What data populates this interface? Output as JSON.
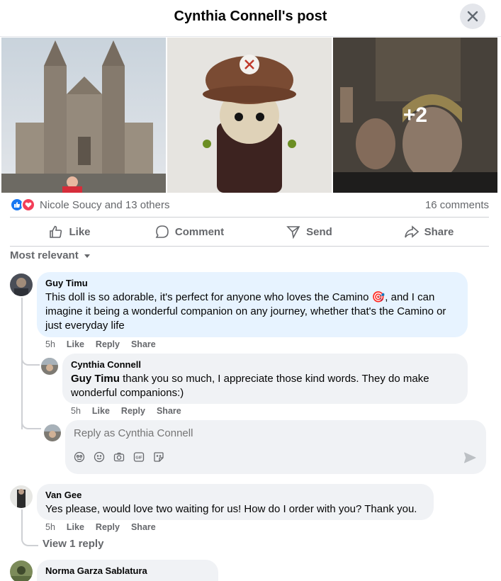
{
  "header": {
    "title": "Cynthia Connell's post"
  },
  "photos": {
    "more_count": "+2"
  },
  "stats": {
    "reactions_text": "Nicole Soucy and 13 others",
    "comments_text": "16 comments"
  },
  "actions": {
    "like": "Like",
    "comment": "Comment",
    "send": "Send",
    "share": "Share"
  },
  "sort": {
    "label": "Most relevant"
  },
  "comments": [
    {
      "author": "Guy Timu",
      "text": "This doll is so adorable, it's perfect for anyone who loves the Camino 🎯, and I can imagine it being a wonderful companion on any journey, whether that's the Camino or just everyday life",
      "time": "5h",
      "like": "Like",
      "reply": "Reply",
      "share": "Share",
      "replies": [
        {
          "author": "Cynthia Connell",
          "mention": "Guy Timu",
          "text": " thank you so much, I appreciate those kind words. They do make wonderful companions:)",
          "time": "5h",
          "like": "Like",
          "reply": "Reply",
          "share": "Share"
        }
      ]
    },
    {
      "author": "Van Gee",
      "text": "Yes please, would love two waiting for us! How do I order with you? Thank you.",
      "time": "5h",
      "like": "Like",
      "reply": "Reply",
      "share": "Share",
      "view_replies": "View 1 reply"
    },
    {
      "author": "Norma Garza Sablatura"
    }
  ],
  "reply_box": {
    "placeholder": "Reply as Cynthia Connell"
  }
}
